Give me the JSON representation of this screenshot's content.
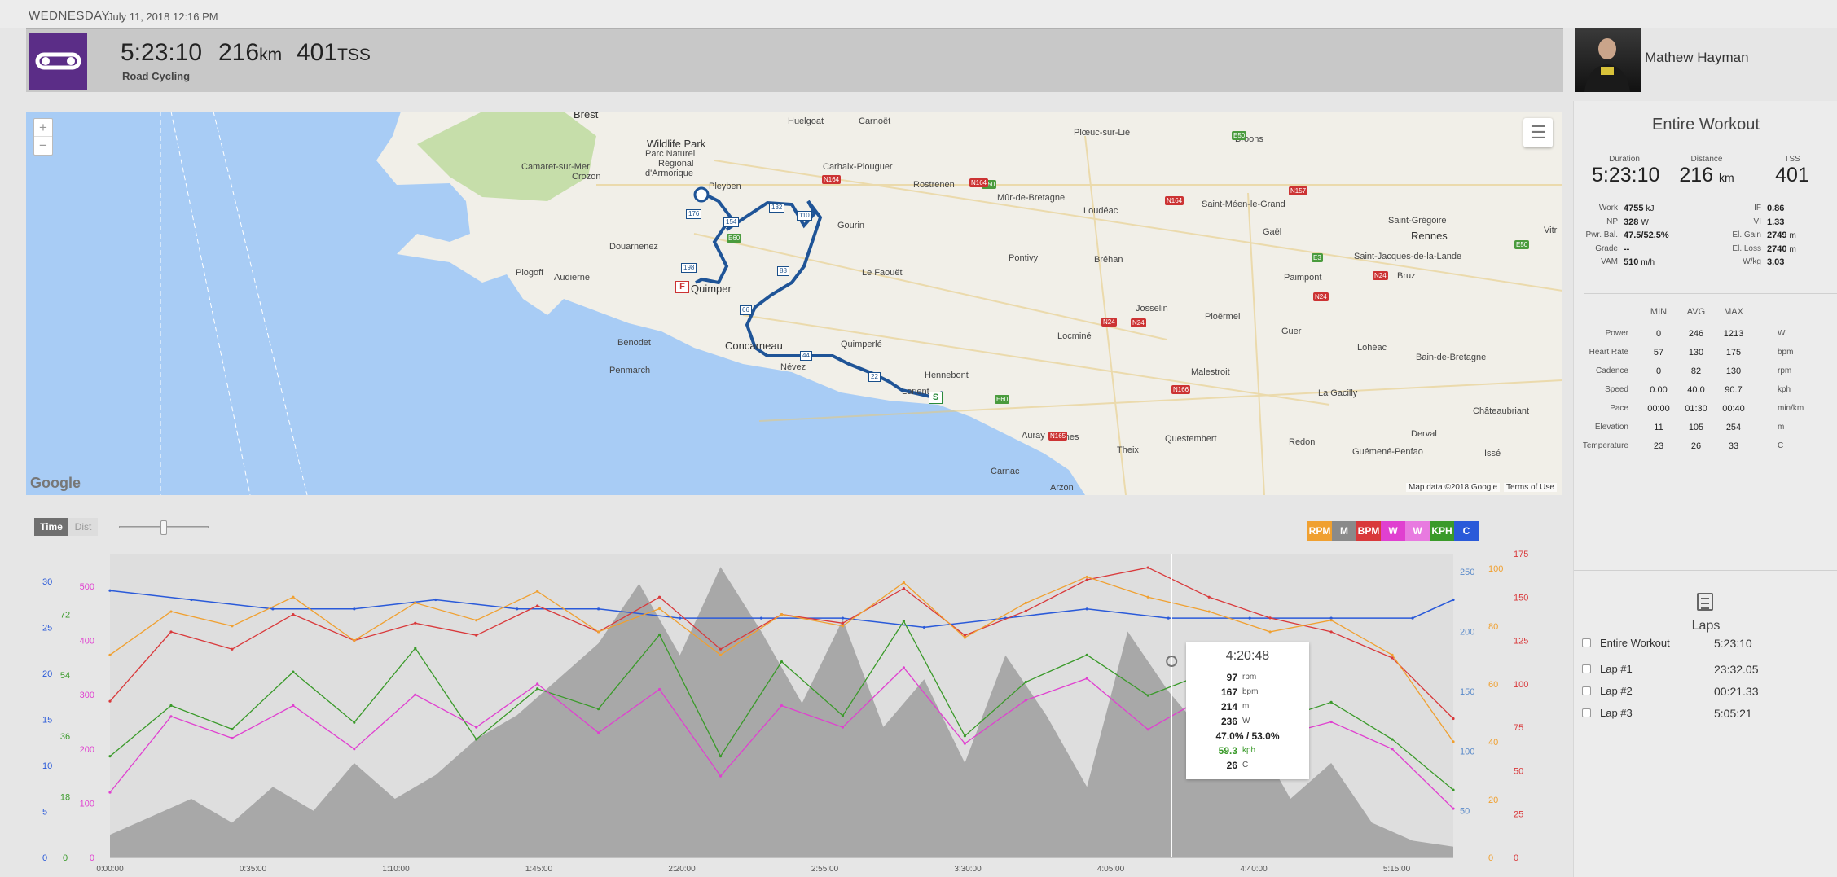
{
  "header": {
    "day": "WEDNESDAY",
    "date": "July 11, 2018 12:16 PM"
  },
  "summary": {
    "duration": "5:23:10",
    "distance": "216",
    "distance_unit": "km",
    "tss": "401",
    "tss_unit": "TSS",
    "sport": "Road Cycling"
  },
  "athlete": {
    "name": "Mathew Hayman"
  },
  "map": {
    "zoom_in": "+",
    "zoom_out": "−",
    "attribution": "Map data ©2018 Google",
    "terms": "Terms of Use",
    "google": "Google",
    "start_marker": "S",
    "finish_marker": "F",
    "places": [
      {
        "name": "Brest",
        "big": true
      },
      {
        "name": "Huelgoat"
      },
      {
        "name": "Carnoët"
      },
      {
        "name": "Plœuc-sur-Lié"
      },
      {
        "name": "Broons"
      },
      {
        "name": "Wildlife Park",
        "big": true
      },
      {
        "name": "Parc Naturel"
      },
      {
        "name": "Régional"
      },
      {
        "name": "d'Armorique"
      },
      {
        "name": "Camaret-sur-Mer"
      },
      {
        "name": "Crozon"
      },
      {
        "name": "Carhaix-Plouguer"
      },
      {
        "name": "Pleyben"
      },
      {
        "name": "Rostrenen"
      },
      {
        "name": "Mûr-de-Bretagne"
      },
      {
        "name": "Saint-Méen-le-Grand"
      },
      {
        "name": "Loudéac"
      },
      {
        "name": "Gourin"
      },
      {
        "name": "Gaël"
      },
      {
        "name": "Saint-Grégoire"
      },
      {
        "name": "Rennes",
        "big": true
      },
      {
        "name": "Douarnenez"
      },
      {
        "name": "Saint-Jacques-de-la-Lande"
      },
      {
        "name": "Plogoff"
      },
      {
        "name": "Audierne"
      },
      {
        "name": "Le Faouët"
      },
      {
        "name": "Pontivy"
      },
      {
        "name": "Bréhan"
      },
      {
        "name": "Paimpont"
      },
      {
        "name": "Bruz"
      },
      {
        "name": "Quimper",
        "big": true
      },
      {
        "name": "Josselin"
      },
      {
        "name": "Ploërmel"
      },
      {
        "name": "Benodet"
      },
      {
        "name": "Concarneau",
        "big": true
      },
      {
        "name": "Quimperlé"
      },
      {
        "name": "Locminé"
      },
      {
        "name": "Guer"
      },
      {
        "name": "Lohéac"
      },
      {
        "name": "Bain-de-Bretagne"
      },
      {
        "name": "Penmarch"
      },
      {
        "name": "Névez"
      },
      {
        "name": "Hennebont"
      },
      {
        "name": "Malestroit"
      },
      {
        "name": "La Gacilly"
      },
      {
        "name": "Lorient"
      },
      {
        "name": "Châteaubriant"
      },
      {
        "name": "Derval"
      },
      {
        "name": "Auray"
      },
      {
        "name": "Vannes"
      },
      {
        "name": "Questembert"
      },
      {
        "name": "Redon"
      },
      {
        "name": "Guémené-Penfao"
      },
      {
        "name": "Theix"
      },
      {
        "name": "Issé"
      },
      {
        "name": "Carnac"
      },
      {
        "name": "Arzon"
      },
      {
        "name": "Vitr"
      }
    ],
    "roads": [
      "N164",
      "E50",
      "N164",
      "E50",
      "N164",
      "N157",
      "E50",
      "N24",
      "N24",
      "E3",
      "N24",
      "N24",
      "N166",
      "E60",
      "N165",
      "E60"
    ],
    "route_marks": [
      "176",
      "154",
      "132",
      "110",
      "198",
      "88",
      "66",
      "44",
      "22"
    ]
  },
  "panel": {
    "title": "Entire Workout",
    "kpis": [
      {
        "label": "Duration",
        "value": "5:23:10",
        "unit": ""
      },
      {
        "label": "Distance",
        "value": "216",
        "unit": "km"
      },
      {
        "label": "TSS",
        "value": "401",
        "unit": ""
      }
    ],
    "stats_left": [
      {
        "label": "Work",
        "value": "4755",
        "unit": "kJ"
      },
      {
        "label": "NP",
        "value": "328",
        "unit": "W"
      },
      {
        "label": "Pwr. Bal.",
        "value": "47.5/52.5%",
        "unit": ""
      },
      {
        "label": "Grade",
        "value": "--",
        "unit": ""
      },
      {
        "label": "VAM",
        "value": "510",
        "unit": "m/h"
      }
    ],
    "stats_right": [
      {
        "label": "IF",
        "value": "0.86",
        "unit": ""
      },
      {
        "label": "VI",
        "value": "1.33",
        "unit": ""
      },
      {
        "label": "El. Gain",
        "value": "2749",
        "unit": "m"
      },
      {
        "label": "El. Loss",
        "value": "2740",
        "unit": "m"
      },
      {
        "label": "W/kg",
        "value": "3.03",
        "unit": ""
      }
    ],
    "mm_headers": {
      "min": "MIN",
      "avg": "AVG",
      "max": "MAX"
    },
    "minmax": [
      {
        "label": "Power",
        "min": "0",
        "avg": "246",
        "max": "1213",
        "unit": "W"
      },
      {
        "label": "Heart Rate",
        "min": "57",
        "avg": "130",
        "max": "175",
        "unit": "bpm"
      },
      {
        "label": "Cadence",
        "min": "0",
        "avg": "82",
        "max": "130",
        "unit": "rpm"
      },
      {
        "label": "Speed",
        "min": "0.00",
        "avg": "40.0",
        "max": "90.7",
        "unit": "kph"
      },
      {
        "label": "Pace",
        "min": "00:00",
        "avg": "01:30",
        "max": "00:40",
        "unit": "min/km"
      },
      {
        "label": "Elevation",
        "min": "11",
        "avg": "105",
        "max": "254",
        "unit": "m"
      },
      {
        "label": "Temperature",
        "min": "23",
        "avg": "26",
        "max": "33",
        "unit": "C"
      }
    ],
    "laps_title": "Laps",
    "laps": [
      {
        "name": "Entire Workout",
        "time": "5:23:10"
      },
      {
        "name": "Lap #1",
        "time": "23:32.05"
      },
      {
        "name": "Lap #2",
        "time": "00:21.33"
      },
      {
        "name": "Lap #3",
        "time": "5:05:21"
      }
    ]
  },
  "chart_tools": {
    "time": "Time",
    "dist": "Dist"
  },
  "legend": [
    {
      "label": "RPM",
      "color": "#f0a030"
    },
    {
      "label": "M",
      "color": "#8a8a8a"
    },
    {
      "label": "BPM",
      "color": "#d9393b"
    },
    {
      "label": "W",
      "color": "#e040d0"
    },
    {
      "label": "W",
      "color": "#e87ae0"
    },
    {
      "label": "KPH",
      "color": "#3a9a2a"
    },
    {
      "label": "C",
      "color": "#2a5ad9"
    }
  ],
  "tooltip": {
    "time": "4:20:48",
    "rows": [
      {
        "value": "97",
        "unit": "rpm"
      },
      {
        "value": "167",
        "unit": "bpm"
      },
      {
        "value": "214",
        "unit": "m"
      },
      {
        "value": "236",
        "unit": "W"
      },
      {
        "value": "47.0% / 53.0%",
        "unit": "",
        "wide": true
      },
      {
        "value": "59.3",
        "unit": "kph",
        "color": "#3a9a2a"
      },
      {
        "value": "26",
        "unit": "C"
      }
    ]
  },
  "chart_data": {
    "type": "line",
    "xlabel": "",
    "ylabel": "",
    "x_ticks": [
      "0:00:00",
      "0:35:00",
      "1:10:00",
      "1:45:00",
      "2:20:00",
      "2:55:00",
      "3:30:00",
      "4:05:00",
      "4:40:00",
      "5:15:00"
    ],
    "x_range_minutes": [
      0,
      330
    ],
    "axes": {
      "temperature_c": {
        "color": "#2a5ad9",
        "ticks": [
          0,
          5,
          10,
          15,
          20,
          25,
          30
        ],
        "range": [
          0,
          33
        ]
      },
      "speed_kph": {
        "color": "#3a9a2a",
        "ticks": [
          0,
          18,
          36,
          54,
          72
        ],
        "range": [
          0,
          90
        ]
      },
      "power_w": {
        "color": "#e040d0",
        "ticks": [
          0,
          100,
          200,
          300,
          400,
          500
        ],
        "range": [
          0,
          560
        ]
      },
      "elevation_m": {
        "color": "#5a8ac9",
        "ticks": [
          50,
          100,
          150,
          200,
          250
        ],
        "range": [
          11,
          265
        ]
      },
      "cadence_rpm": {
        "color": "#f0a030",
        "ticks": [
          0,
          20,
          40,
          60,
          80,
          100
        ],
        "range": [
          0,
          105
        ]
      },
      "heart_rate_bpm": {
        "color": "#d9393b",
        "ticks": [
          0,
          25,
          50,
          75,
          100,
          125,
          150,
          175
        ],
        "range": [
          0,
          175
        ]
      }
    },
    "series": [
      {
        "name": "Elevation",
        "unit": "m",
        "color": "#8a8a8a",
        "x": [
          0,
          10,
          20,
          30,
          40,
          50,
          60,
          70,
          80,
          90,
          100,
          110,
          120,
          130,
          140,
          150,
          160,
          170,
          180,
          190,
          200,
          210,
          220,
          230,
          240,
          250,
          260,
          270,
          280,
          290,
          300,
          310,
          320,
          330
        ],
        "values": [
          30,
          45,
          60,
          40,
          70,
          50,
          90,
          60,
          80,
          110,
          130,
          160,
          190,
          240,
          180,
          254,
          200,
          140,
          210,
          120,
          160,
          90,
          180,
          130,
          70,
          200,
          150,
          110,
          120,
          60,
          90,
          40,
          25,
          20
        ]
      },
      {
        "name": "Temperature",
        "unit": "C",
        "color": "#2a5ad9",
        "x": [
          0,
          20,
          40,
          60,
          80,
          100,
          120,
          140,
          160,
          180,
          200,
          220,
          240,
          260,
          280,
          300,
          320,
          330
        ],
        "values": [
          29,
          28,
          27,
          27,
          28,
          27,
          27,
          26,
          26,
          26,
          25,
          26,
          27,
          26,
          26,
          26,
          26,
          28
        ]
      },
      {
        "name": "Speed",
        "unit": "kph",
        "color": "#3a9a2a",
        "x": [
          0,
          15,
          30,
          45,
          60,
          75,
          90,
          105,
          120,
          135,
          150,
          165,
          180,
          195,
          210,
          225,
          240,
          255,
          270,
          285,
          300,
          315,
          330
        ],
        "values": [
          30,
          45,
          38,
          55,
          40,
          62,
          35,
          50,
          44,
          66,
          30,
          58,
          42,
          70,
          36,
          52,
          60,
          48,
          55,
          40,
          46,
          35,
          20
        ]
      },
      {
        "name": "Heart Rate",
        "unit": "bpm",
        "color": "#d9393b",
        "x": [
          0,
          15,
          30,
          45,
          60,
          75,
          90,
          105,
          120,
          135,
          150,
          165,
          180,
          195,
          210,
          225,
          240,
          255,
          270,
          285,
          300,
          315,
          330
        ],
        "values": [
          90,
          130,
          120,
          140,
          125,
          135,
          128,
          145,
          130,
          150,
          120,
          140,
          135,
          155,
          128,
          142,
          160,
          167,
          150,
          138,
          130,
          115,
          80
        ]
      },
      {
        "name": "Cadence",
        "unit": "rpm",
        "color": "#f0a030",
        "x": [
          0,
          15,
          30,
          45,
          60,
          75,
          90,
          105,
          120,
          135,
          150,
          165,
          180,
          195,
          210,
          225,
          240,
          255,
          270,
          285,
          300,
          315,
          330
        ],
        "values": [
          70,
          85,
          80,
          90,
          75,
          88,
          82,
          92,
          78,
          86,
          70,
          84,
          80,
          95,
          76,
          88,
          97,
          90,
          85,
          78,
          82,
          70,
          40
        ]
      },
      {
        "name": "Power",
        "unit": "W",
        "color": "#e040d0",
        "x": [
          0,
          15,
          30,
          45,
          60,
          75,
          90,
          105,
          120,
          135,
          150,
          165,
          180,
          195,
          210,
          225,
          240,
          255,
          270,
          285,
          300,
          315,
          330
        ],
        "values": [
          120,
          260,
          220,
          280,
          200,
          300,
          240,
          320,
          230,
          310,
          150,
          280,
          240,
          350,
          210,
          290,
          330,
          236,
          300,
          220,
          250,
          200,
          90
        ]
      }
    ]
  }
}
